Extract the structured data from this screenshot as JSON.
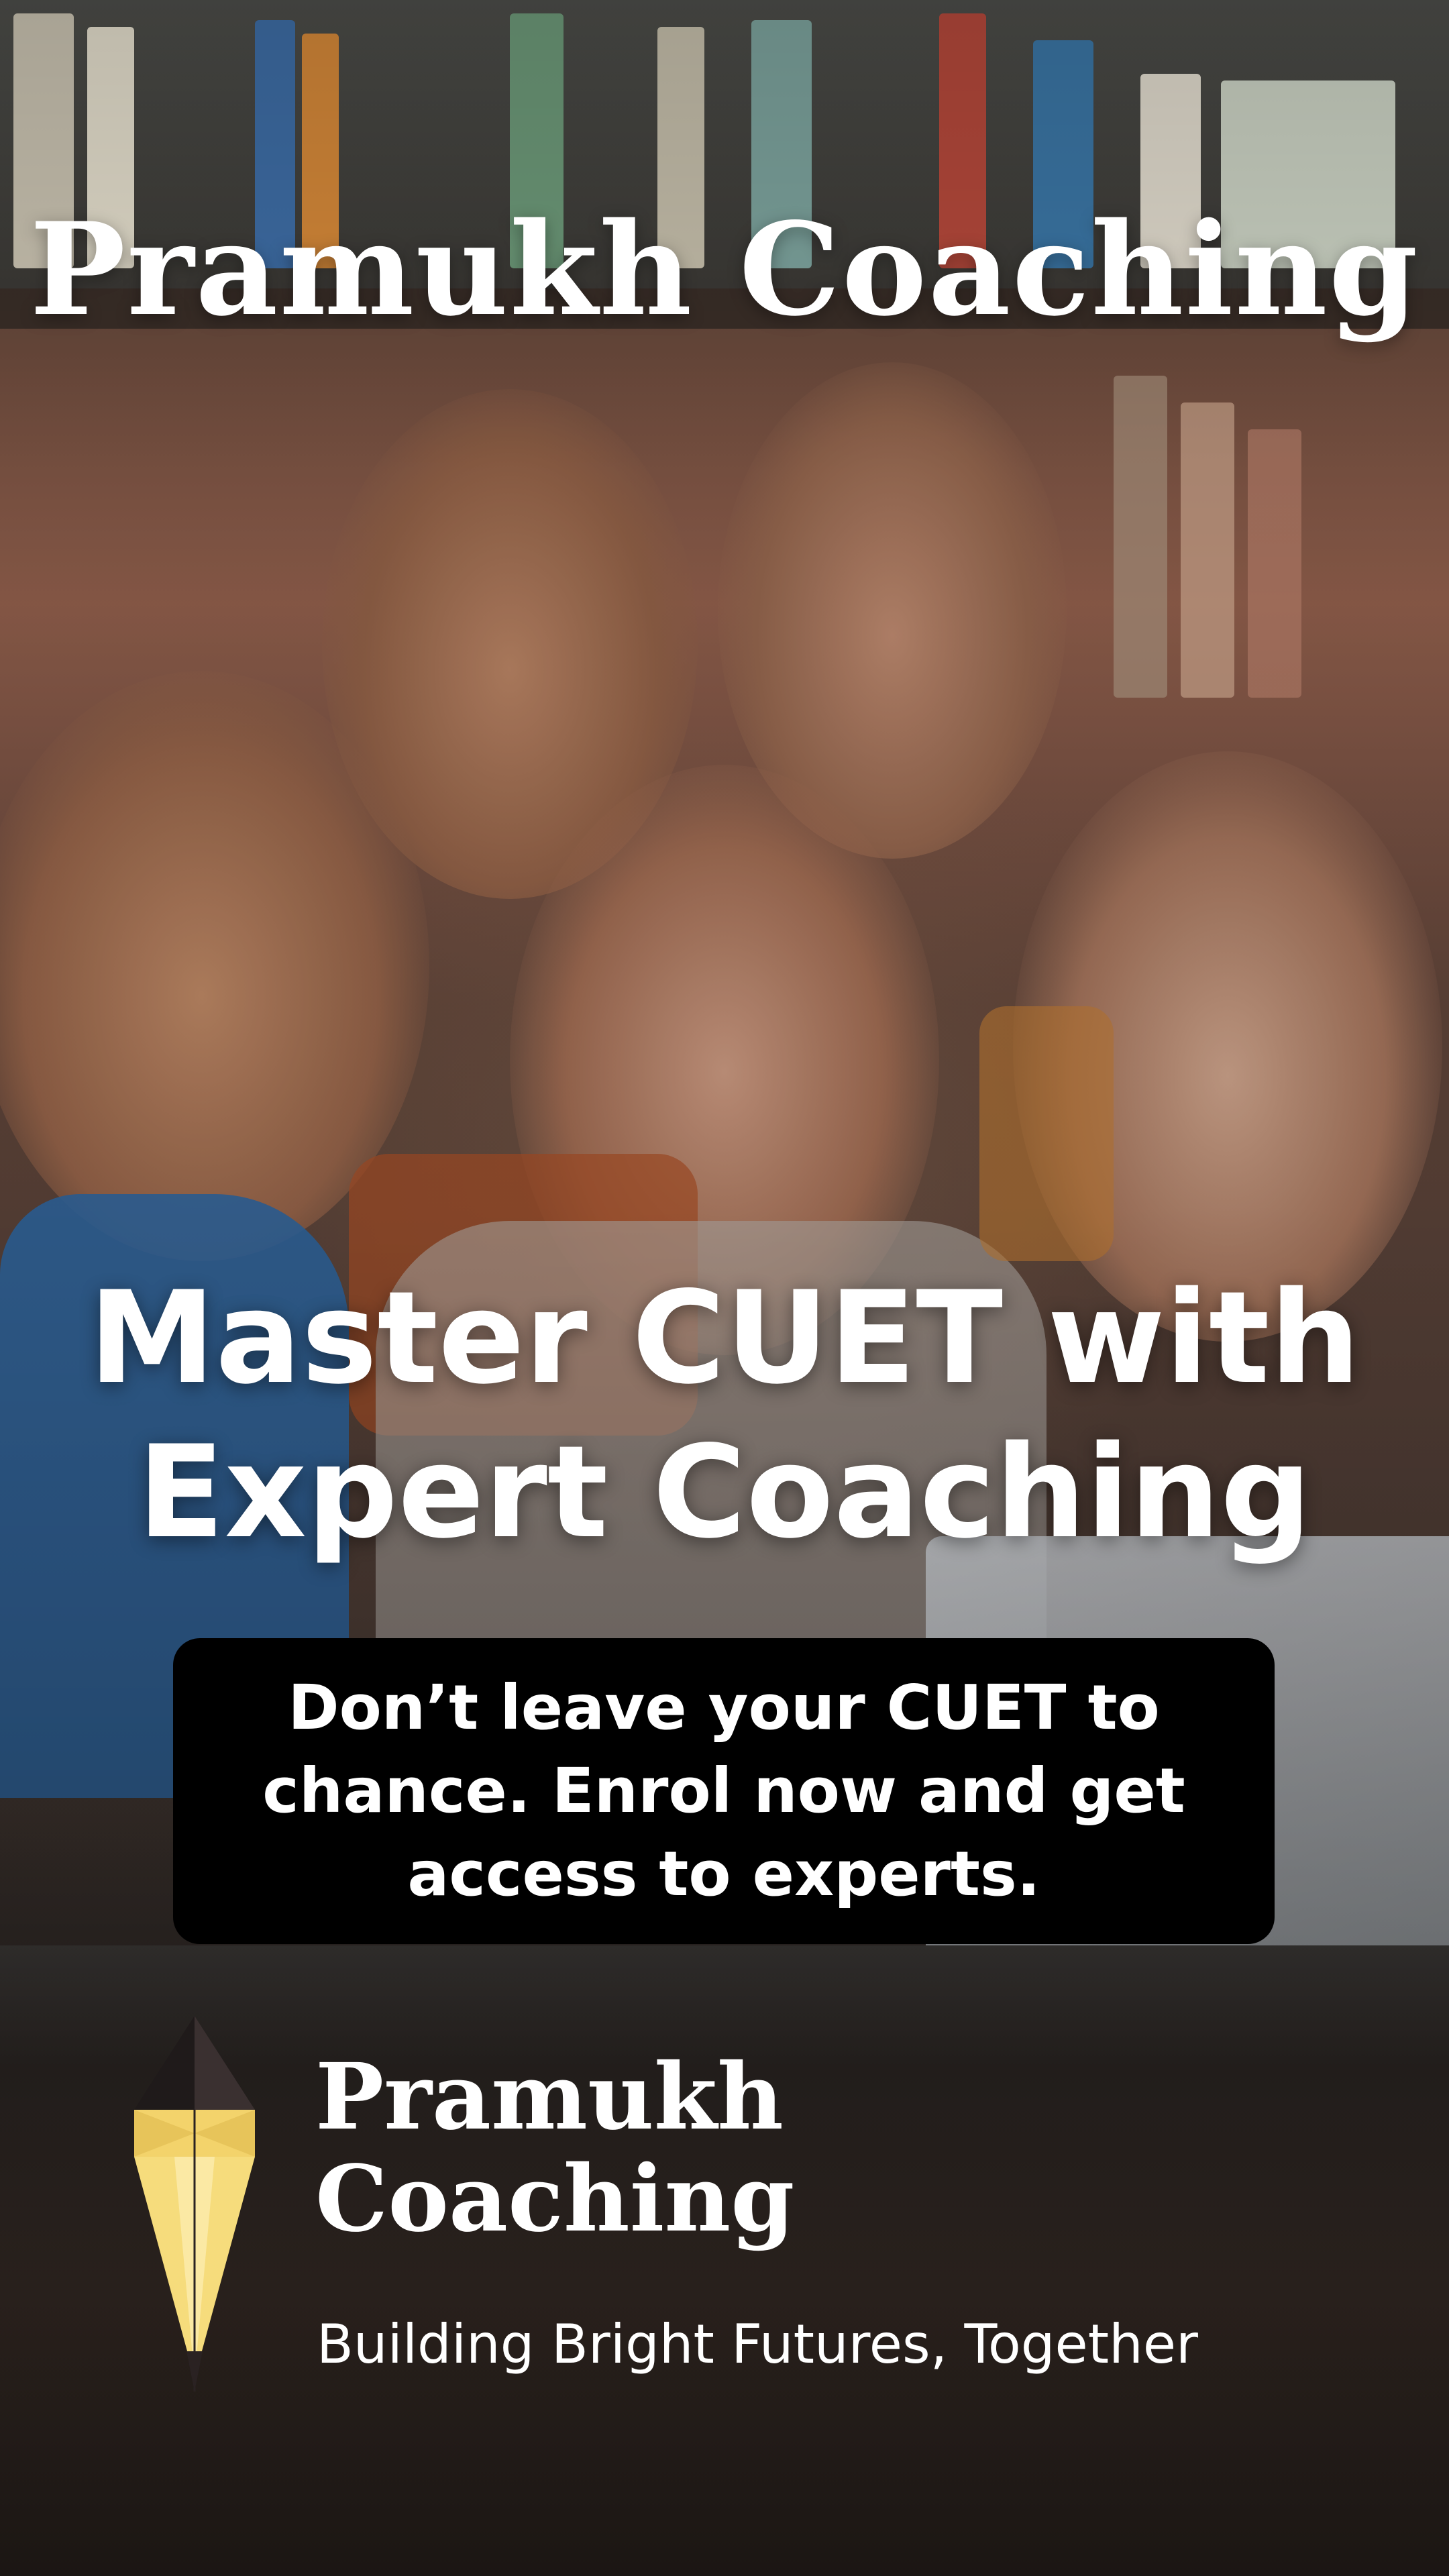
{
  "header": {
    "brand": "Pramukh Coaching"
  },
  "hero": {
    "headline_line1": "Master CUET with",
    "headline_line2": "Expert Coaching"
  },
  "cta": {
    "text": "Don’t leave your CUET to chance. Enrol now and get access to experts."
  },
  "footer": {
    "brand_line1": "Pramukh",
    "brand_line2": "Coaching",
    "tagline": "Building Bright Futures, Together",
    "logo_icon": "pencil-nib-icon"
  },
  "colors": {
    "text": "#ffffff",
    "cta_background": "#000000",
    "logo_yellow": "#f3d36b",
    "logo_dark": "#2a2222"
  }
}
